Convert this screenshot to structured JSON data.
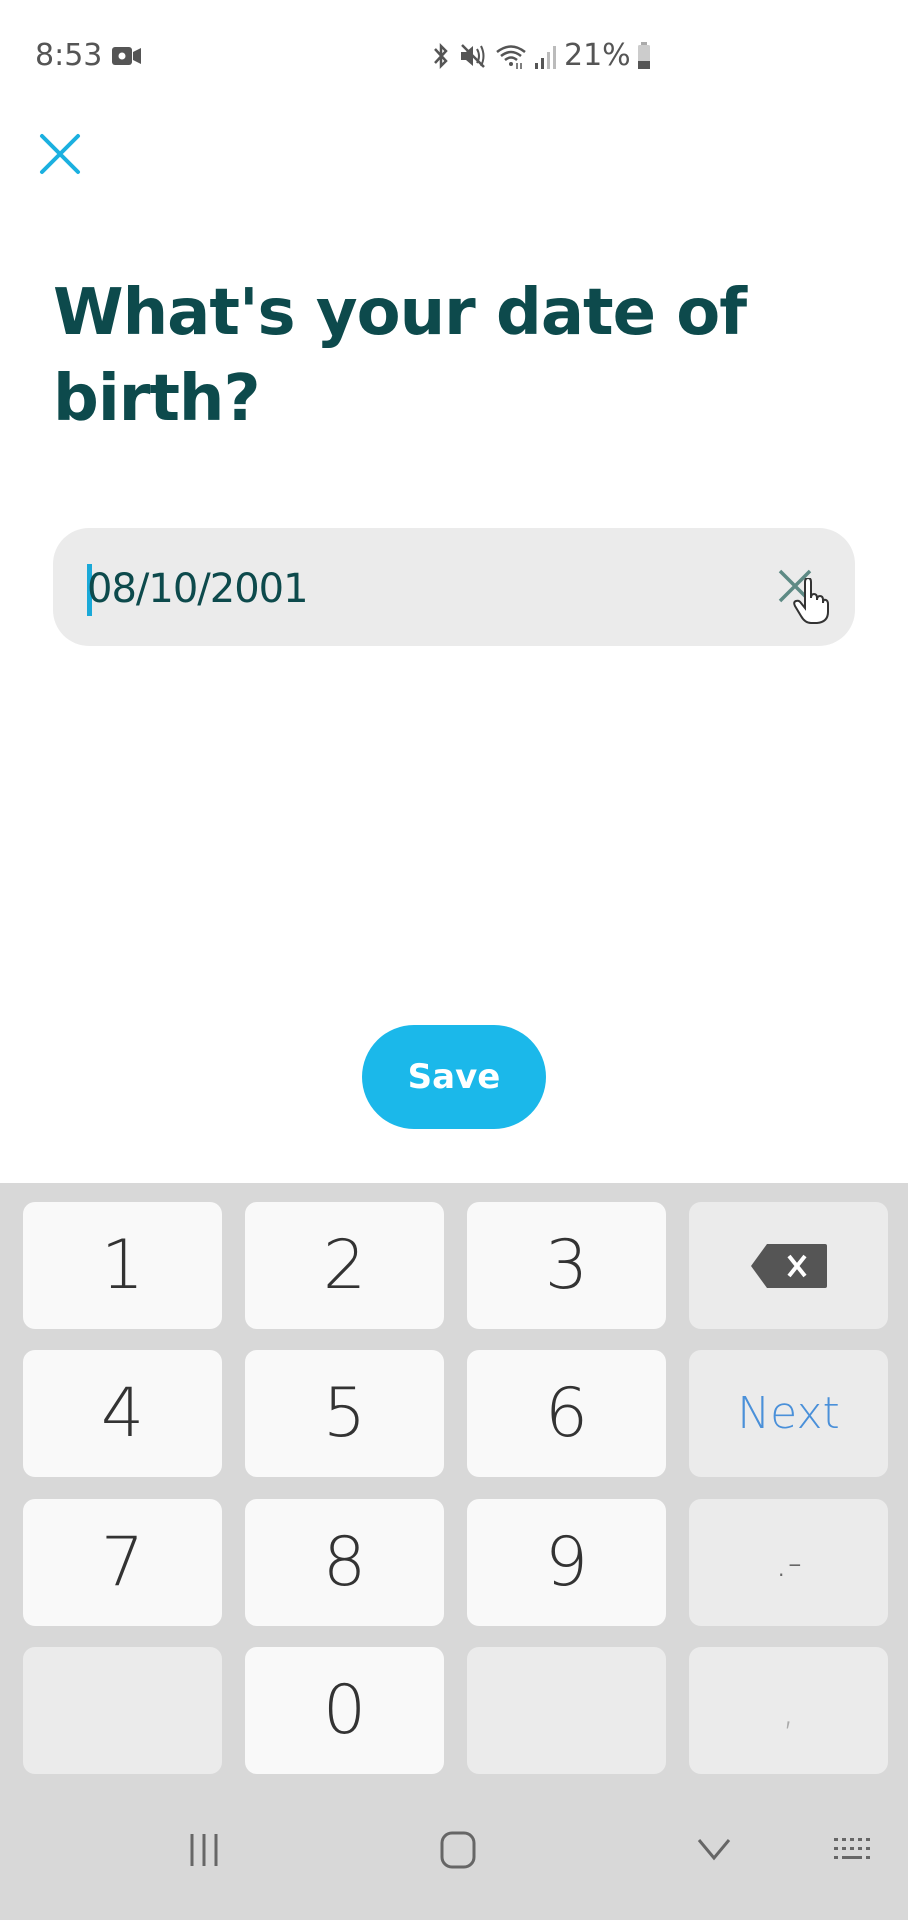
{
  "status_bar": {
    "time": "8:53",
    "battery": "21%",
    "icons": [
      "video-camera-icon",
      "bluetooth-icon",
      "mute-icon",
      "wifi-icon",
      "signal-icon",
      "battery-icon"
    ]
  },
  "header": {
    "close_icon": "close-icon"
  },
  "page": {
    "title": "What's your date of birth?"
  },
  "date_field": {
    "value": "08/10/2001",
    "clear_icon": "clear-icon"
  },
  "save_button": {
    "label": "Save"
  },
  "keyboard": {
    "keys": [
      [
        "1",
        "2",
        "3",
        "backspace"
      ],
      [
        "4",
        "5",
        "6",
        "Next"
      ],
      [
        "7",
        "8",
        "9",
        ".-"
      ],
      [
        "",
        "0",
        "",
        ","
      ]
    ],
    "backspace_icon": "backspace-icon"
  },
  "nav_bar": {
    "icons": [
      "recent-apps-icon",
      "home-icon",
      "hide-keyboard-icon",
      "keyboard-switch-icon"
    ]
  },
  "colors": {
    "accent": "#1bb8ea",
    "title": "#0d4a4c",
    "field_bg": "#ebebeb",
    "keyboard_bg": "#d8d8d8",
    "next_blue": "#4a90d9"
  }
}
